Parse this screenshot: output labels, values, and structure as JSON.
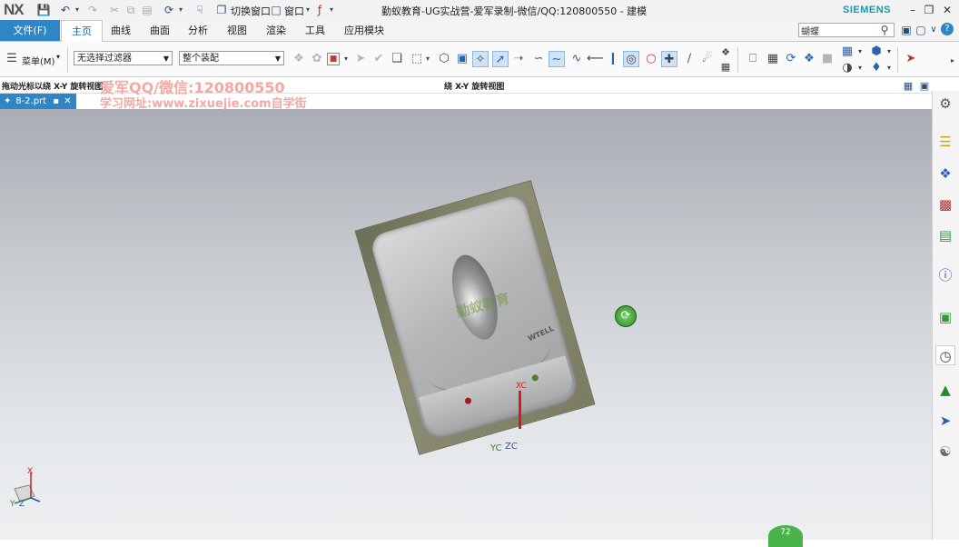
{
  "app": {
    "logo": "NX",
    "title": "勤蚁教育-UG实战营-爱军录制-微信/QQ:120800550 - 建模",
    "brand": "SIEMENS",
    "quick_access": {
      "switch_window": "切换窗口",
      "window": "窗口"
    }
  },
  "ribbon": {
    "file_tab": "文件(F)",
    "tabs": [
      "主页",
      "曲线",
      "曲面",
      "分析",
      "视图",
      "渲染",
      "工具",
      "应用模块"
    ],
    "active_tab": "主页",
    "search_value": "蝴蝶"
  },
  "toolbar": {
    "menu_label": "菜单(M)",
    "filter_value": "无选择过滤器",
    "assembly_value": "整个装配"
  },
  "cue": {
    "left": "拖动光标以绕 X-Y 旋转视图",
    "center": "绕 X-Y 旋转视图"
  },
  "watermark": {
    "line1": "爱军QQ/微信:120800550",
    "line2": "学习网址:www.zixuejie.com自学街"
  },
  "document_tab": {
    "name": "8-2.prt"
  },
  "model": {
    "watermark": "勤蚁教育",
    "brand": "WTELL",
    "wcs": {
      "x": "XC",
      "y": "YC",
      "z": "ZC"
    }
  },
  "triad": {
    "x": "X",
    "y": "Y",
    "z": "Z"
  },
  "fps_badge": "72",
  "colors": {
    "accent": "#2f86c6",
    "brand": "#129bb2",
    "watermark": "#f2a9a2"
  }
}
